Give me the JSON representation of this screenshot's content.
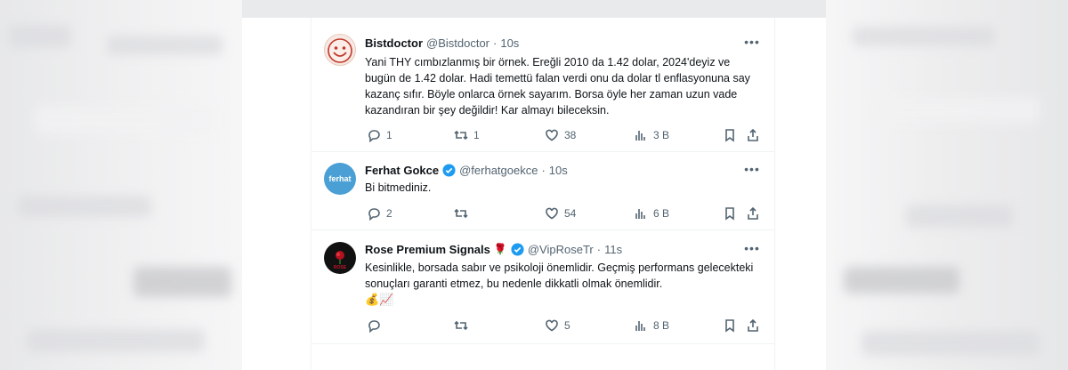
{
  "tweets": [
    {
      "name": "Bistdoctor",
      "handle": "@Bistdoctor",
      "time": "10s",
      "text": "Yani THY cımbızlanmış bir örnek. Ereğli 2010 da 1.42 dolar, 2024'deyiz ve bugün de 1.42 dolar. Hadi temettü falan verdi onu da dolar tl enflasyonuna say kazanç sıfır. Böyle onlarca örnek sayarım. Borsa öyle her zaman uzun vade kazandıran bir şey değildir! Kar almayı bileceksin.",
      "replies": "1",
      "retweets": "1",
      "likes": "38",
      "views": "3 B",
      "avatar_icon": "smiley-face-icon",
      "verified": false
    },
    {
      "name": "Ferhat Gokce",
      "handle": "@ferhatgoekce",
      "time": "10s",
      "text": "Bi bitmediniz.",
      "replies": "2",
      "retweets": "",
      "likes": "54",
      "views": "6 B",
      "avatar_text": "ferhat",
      "verified": true
    },
    {
      "name": "Rose Premium Signals",
      "handle": "@VipRoseTr",
      "time": "11s",
      "text": "Kesinlikle, borsada sabır ve psikoloji önemlidir. Geçmiş performans gelecekteki sonuçları garanti etmez, bu nedenle dikkatli olmak önemlidir.",
      "emojis": "💰📈",
      "name_emoji": "🌹",
      "replies": "",
      "retweets": "",
      "likes": "5",
      "views": "8 B",
      "avatar_text": "ROSE",
      "verified": true
    }
  ],
  "colors": {
    "text_primary": "#0f1419",
    "text_secondary": "#536471",
    "verified_blue": "#1d9bf0",
    "ferhat_avatar": "#4a9fd4",
    "rose_avatar": "#111111"
  }
}
